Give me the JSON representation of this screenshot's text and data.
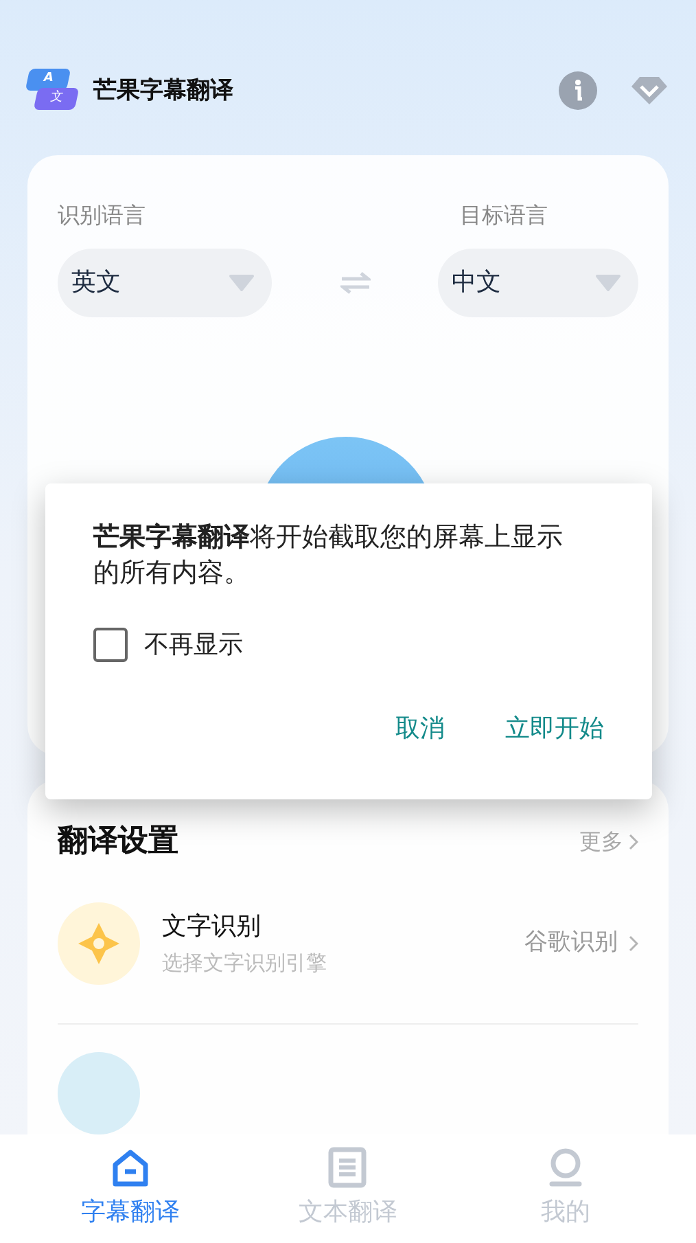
{
  "app": {
    "title": "芒果字幕翻译",
    "logo_top": "A",
    "logo_bottom": "文"
  },
  "languages": {
    "source_label": "识别语言",
    "source_value": "英文",
    "target_label": "目标语言",
    "target_value": "中文"
  },
  "dialog": {
    "app_name": "芒果字幕翻译",
    "message": "将开始截取您的屏幕上显示的所有内容。",
    "checkbox": {
      "label": "不再显示",
      "checked": false
    },
    "buttons": [
      "取消",
      "立即开始"
    ]
  },
  "settings": {
    "title": "翻译设置",
    "more": "更多",
    "items": [
      {
        "title": "文字识别",
        "subtitle": "选择文字识别引擎",
        "value": "谷歌识别"
      }
    ]
  },
  "nav": [
    {
      "label": "字幕翻译",
      "kind": "home",
      "selected": true
    },
    {
      "label": "文本翻译",
      "kind": "document",
      "selected": false
    },
    {
      "label": "我的",
      "kind": "user",
      "selected": false
    }
  ]
}
